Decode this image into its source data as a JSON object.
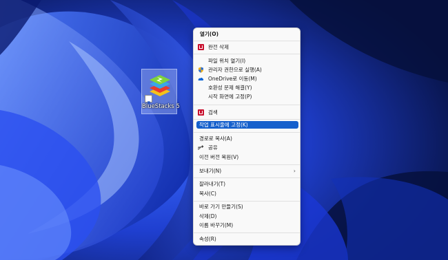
{
  "desktop": {
    "icon": {
      "label": "BlueStacks 5"
    }
  },
  "context_menu": {
    "items": [
      {
        "label": "열기(O)",
        "icon": "",
        "bold": true
      },
      {
        "label": "완전 삭제",
        "icon": "mcafee-icon"
      },
      {
        "label": "파일 위치 열기(I)",
        "icon": ""
      },
      {
        "label": "관리자 권한으로 실행(A)",
        "icon": "uac-shield-icon"
      },
      {
        "label": "OneDrive로 이동(M)",
        "icon": "onedrive-cloud-icon"
      },
      {
        "label": "호환성 문제 해결(Y)",
        "icon": ""
      },
      {
        "label": "시작 화면에 고정(P)",
        "icon": ""
      },
      {
        "label": "검색",
        "icon": "mcafee-icon"
      },
      {
        "label": "작업 표시줄에 고정(K)",
        "icon": "",
        "selected": true
      },
      {
        "label": "경로로 복사(A)",
        "icon": ""
      },
      {
        "label": "공유",
        "icon": "share-icon"
      },
      {
        "label": "이전 버전 복원(V)",
        "icon": ""
      },
      {
        "label": "보내기(N)",
        "icon": "",
        "submenu": true
      },
      {
        "label": "잘라내기(T)",
        "icon": ""
      },
      {
        "label": "복사(C)",
        "icon": ""
      },
      {
        "label": "바로 가기 만들기(S)",
        "icon": ""
      },
      {
        "label": "삭제(D)",
        "icon": ""
      },
      {
        "label": "이름 바꾸기(M)",
        "icon": ""
      },
      {
        "label": "속성(R)",
        "icon": ""
      }
    ],
    "submenu_arrow": "›",
    "colors": {
      "selected_bg": "#1560cc",
      "menu_bg": "#f9f9f9",
      "mcafee_red": "#c8102e"
    }
  }
}
